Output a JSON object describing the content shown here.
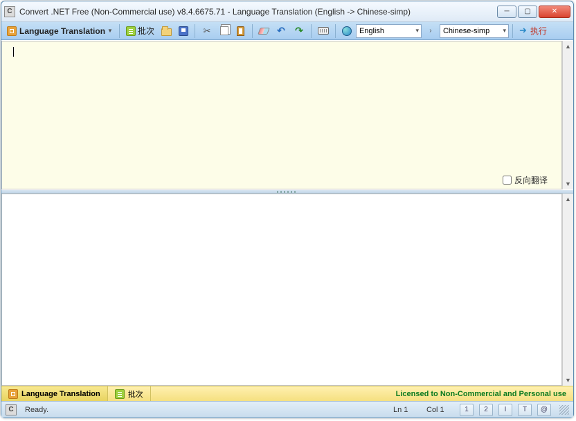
{
  "window": {
    "title": "Convert .NET Free (Non-Commercial use) v8.4.6675.71 - Language Translation (English -> Chinese-simp)"
  },
  "toolbar": {
    "mode_label": "Language Translation",
    "batch_label": "批次",
    "source_lang": "English",
    "target_lang": "Chinese-simp",
    "run_label": "执行"
  },
  "panes": {
    "reverse_label": "反向翻译"
  },
  "tabs": {
    "translation": "Language Translation",
    "batch": "批次"
  },
  "license": "Licensed to Non-Commercial and Personal use",
  "status": {
    "ready": "Ready.",
    "line": "Ln 1",
    "col": "Col 1",
    "btns": [
      "1",
      "2",
      "I",
      "T",
      "@"
    ]
  }
}
